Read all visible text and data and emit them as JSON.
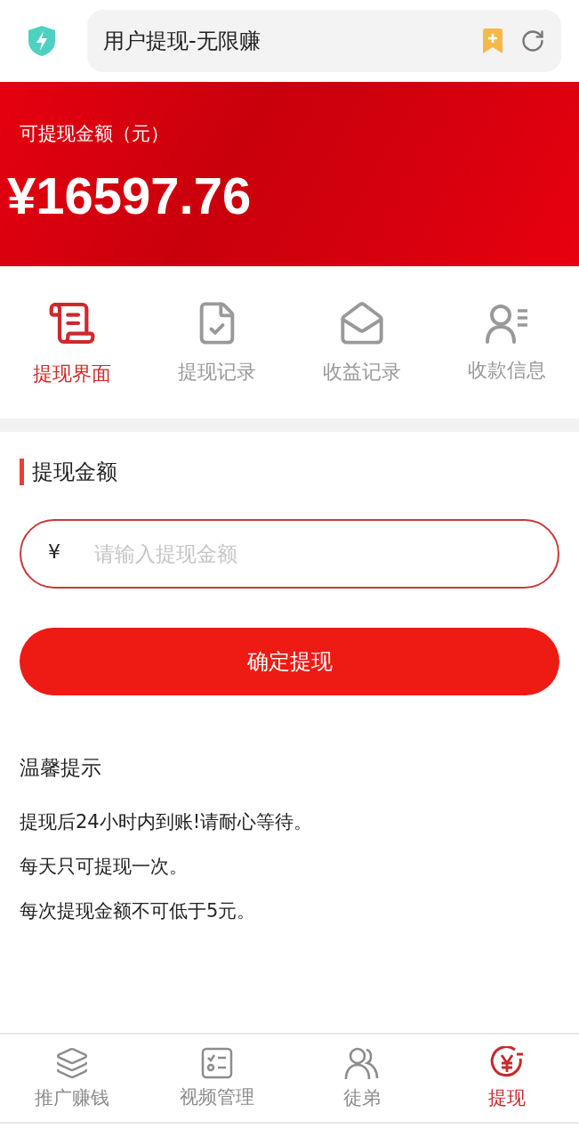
{
  "address_bar": {
    "title": "用户提现-无限赚"
  },
  "balance": {
    "label": "可提现金额（元）",
    "amount": "¥16597.76"
  },
  "tabs": [
    {
      "label": "提现界面",
      "selected": true
    },
    {
      "label": "提现记录",
      "selected": false
    },
    {
      "label": "收益记录",
      "selected": false
    },
    {
      "label": "收款信息",
      "selected": false
    }
  ],
  "form": {
    "title": "提现金额",
    "currency": "¥",
    "placeholder": "请输入提现金额",
    "submit": "确定提现"
  },
  "notice": {
    "title": "温馨提示",
    "lines": [
      "提现后24小时内到账!请耐心等待。",
      "每天只可提现一次。",
      "每次提现金额不可低于5元。"
    ]
  },
  "bottom_nav": [
    {
      "label": "推广赚钱",
      "selected": false
    },
    {
      "label": "视频管理",
      "selected": false
    },
    {
      "label": "徒弟",
      "selected": false
    },
    {
      "label": "提现",
      "selected": true
    }
  ]
}
